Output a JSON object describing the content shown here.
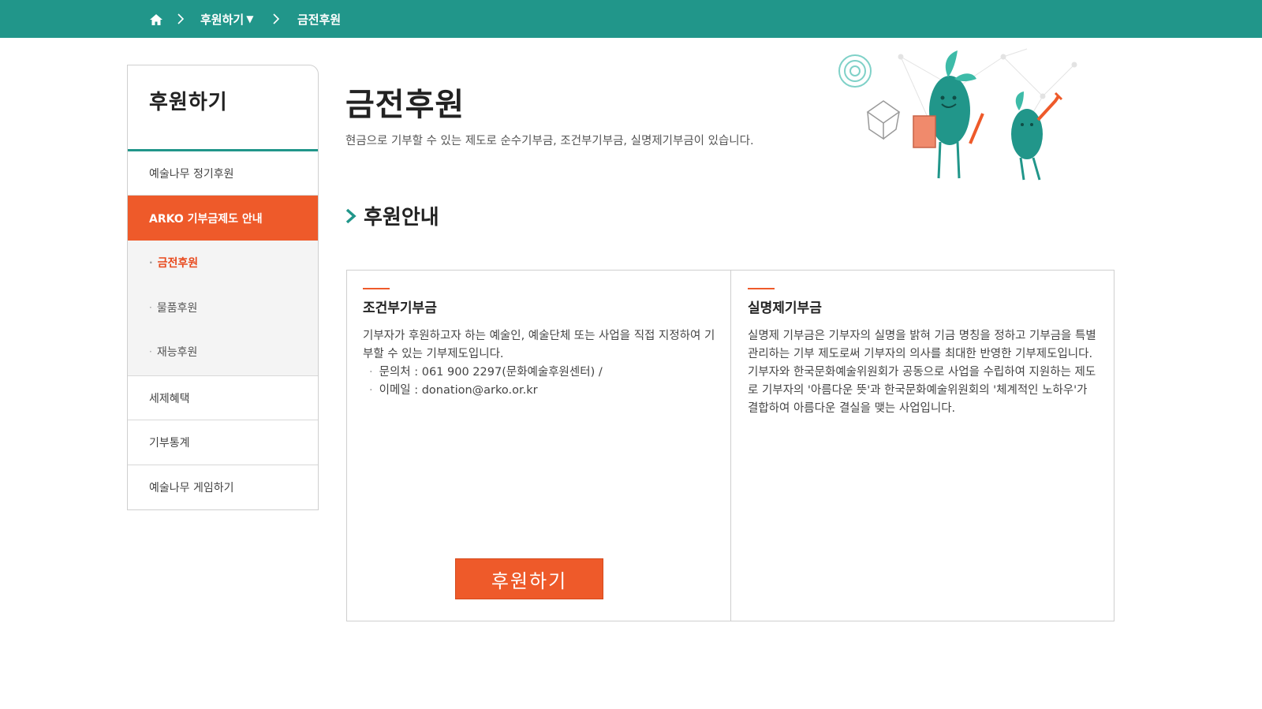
{
  "breadcrumb": {
    "home_icon": "home-icon",
    "items": [
      "후원하기",
      "금전후원"
    ],
    "dropdown_marker": "▼"
  },
  "sidebar": {
    "title": "후원하기",
    "items": [
      {
        "label": "예술나무 정기후원"
      },
      {
        "label": "ARKO 기부금제도 안내",
        "active": true
      }
    ],
    "sub_items": [
      {
        "label": "금전후원",
        "current": true
      },
      {
        "label": "물품후원"
      },
      {
        "label": "재능후원"
      }
    ],
    "bottom_items": [
      {
        "label": "세제혜택"
      },
      {
        "label": "기부통계"
      },
      {
        "label": "예술나무 게임하기"
      }
    ]
  },
  "main": {
    "title": "금전후원",
    "description": "현금으로 기부할 수 있는 제도로 순수기부금, 조건부기부금, 실명제기부금이 있습니다.",
    "section_title": "후원안내",
    "columns": [
      {
        "title": "조건부기부금",
        "body": "기부자가 후원하고자 하는 예술인, 예술단체 또는 사업을 직접 지정하여 기부할 수 있는 기부제도입니다.",
        "bullets": [
          "문의처 : 061 900 2297(문화예술후원센터) /",
          "이메일 : donation@arko.or.kr"
        ]
      },
      {
        "title": "실명제기부금",
        "body": "실명제 기부금은 기부자의 실명을 밝혀 기금 명칭을 정하고 기부금을 특별관리하는 기부 제도로써 기부자의 의사를 최대한 반영한 기부제도입니다.",
        "body2": "기부자와 한국문화예술위원회가 공동으로 사업을 수립하여 지원하는 제도로 기부자의 '아름다운 뜻'과 한국문화예술위원회의 '체계적인 노하우'가 결합하여 아름다운 결실을 맺는 사업입니다."
      }
    ],
    "donate_button": "후원하기"
  },
  "colors": {
    "brand_teal": "#21968a",
    "accent_orange": "#ee5a2a"
  }
}
